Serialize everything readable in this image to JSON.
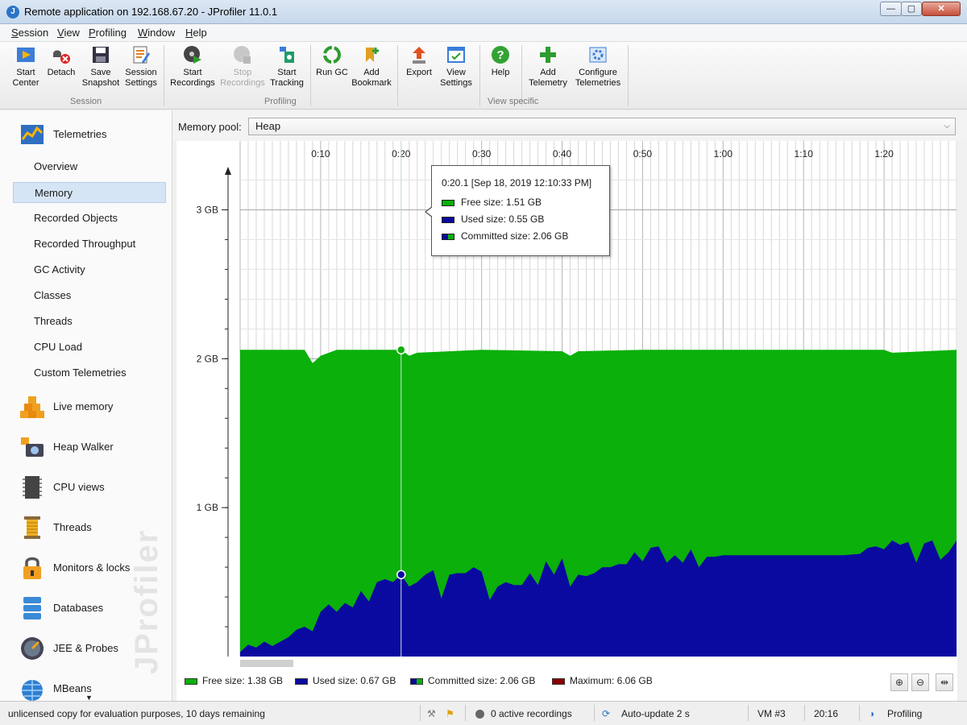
{
  "window": {
    "title": "Remote application on 192.168.67.20 - JProfiler 11.0.1",
    "min": "—",
    "max": "▢",
    "close": "✕"
  },
  "menu": [
    "Session",
    "View",
    "Profiling",
    "Window",
    "Help"
  ],
  "toolbar": {
    "buttons": [
      {
        "l1": "Start",
        "l2": "Center",
        "icon": "start-center-icon"
      },
      {
        "l1": "Detach",
        "l2": "",
        "icon": "detach-icon"
      },
      {
        "l1": "Save",
        "l2": "Snapshot",
        "icon": "save-icon"
      },
      {
        "l1": "Session",
        "l2": "Settings",
        "icon": "session-settings-icon"
      },
      {
        "l1": "Start",
        "l2": "Recordings",
        "icon": "start-recordings-icon"
      },
      {
        "l1": "Stop",
        "l2": "Recordings",
        "icon": "stop-recordings-icon"
      },
      {
        "l1": "Start",
        "l2": "Tracking",
        "icon": "start-tracking-icon"
      },
      {
        "l1": "Run GC",
        "l2": "",
        "icon": "run-gc-icon"
      },
      {
        "l1": "Add",
        "l2": "Bookmark",
        "icon": "add-bookmark-icon"
      },
      {
        "l1": "Export",
        "l2": "",
        "icon": "export-icon"
      },
      {
        "l1": "View",
        "l2": "Settings",
        "icon": "view-settings-icon"
      },
      {
        "l1": "Help",
        "l2": "",
        "icon": "help-icon"
      },
      {
        "l1": "Add",
        "l2": "Telemetry",
        "icon": "add-telemetry-icon"
      },
      {
        "l1": "Configure",
        "l2": "Telemetries",
        "icon": "configure-telemetries-icon"
      }
    ],
    "groups": [
      "Session",
      "Profiling",
      "View specific"
    ]
  },
  "sidebar": {
    "telemetries": "Telemetries",
    "items": [
      "Overview",
      "Memory",
      "Recorded Objects",
      "Recorded Throughput",
      "GC Activity",
      "Classes",
      "Threads",
      "CPU Load",
      "Custom Telemetries"
    ],
    "selected": "Memory",
    "sections": [
      "Live memory",
      "Heap Walker",
      "CPU views",
      "Threads",
      "Monitors & locks",
      "Databases",
      "JEE & Probes",
      "MBeans"
    ],
    "watermark": "JProfiler",
    "more": "▼"
  },
  "memory_pool": {
    "label": "Memory pool:",
    "value": "Heap",
    "chevron": "⌵"
  },
  "colors": {
    "free": "#0bb00b",
    "used": "#0a0aa0",
    "maximum": "#8b0000"
  },
  "chart_data": {
    "type": "area",
    "x_unit": "seconds",
    "x_ticks": [
      "0:10",
      "0:20",
      "0:30",
      "0:40",
      "0:50",
      "1:00",
      "1:10",
      "1:20"
    ],
    "x_tick_seconds": [
      10,
      20,
      30,
      40,
      50,
      60,
      70,
      80
    ],
    "x_range": [
      0,
      89
    ],
    "y_ticks": [
      "1 GB",
      "2 GB",
      "3 GB"
    ],
    "y_tick_values": [
      1,
      2,
      3
    ],
    "y_range": [
      0,
      3.3
    ],
    "y_unit": "GB",
    "series": [
      {
        "name": "Committed size",
        "x": [
          0,
          8,
          9,
          10,
          12,
          20,
          21,
          22,
          30,
          40,
          41,
          42,
          50,
          60,
          70,
          80,
          81,
          89
        ],
        "values": [
          2.06,
          2.06,
          1.97,
          2.02,
          2.06,
          2.06,
          2.02,
          2.04,
          2.06,
          2.05,
          2.02,
          2.05,
          2.06,
          2.06,
          2.06,
          2.06,
          2.04,
          2.06
        ]
      },
      {
        "name": "Used size",
        "x": [
          0,
          1,
          2,
          3,
          4,
          5,
          6,
          7,
          8,
          9,
          10,
          11,
          12,
          13,
          14,
          15,
          16,
          17,
          18,
          19,
          20,
          21,
          22,
          23,
          24,
          25,
          26,
          27,
          28,
          29,
          30,
          31,
          32,
          33,
          34,
          35,
          36,
          37,
          38,
          39,
          40,
          41,
          42,
          43,
          44,
          45,
          46,
          47,
          48,
          49,
          50,
          51,
          52,
          53,
          54,
          55,
          56,
          57,
          58,
          59,
          60,
          65,
          70,
          75,
          77,
          78,
          79,
          80,
          81,
          82,
          83,
          84,
          85,
          86,
          87,
          88,
          89
        ],
        "values": [
          0.03,
          0.08,
          0.06,
          0.1,
          0.07,
          0.1,
          0.13,
          0.18,
          0.2,
          0.17,
          0.3,
          0.35,
          0.3,
          0.36,
          0.33,
          0.44,
          0.37,
          0.5,
          0.52,
          0.5,
          0.55,
          0.47,
          0.5,
          0.55,
          0.58,
          0.39,
          0.55,
          0.56,
          0.56,
          0.6,
          0.57,
          0.38,
          0.47,
          0.5,
          0.48,
          0.48,
          0.56,
          0.48,
          0.64,
          0.55,
          0.66,
          0.47,
          0.55,
          0.54,
          0.56,
          0.6,
          0.6,
          0.62,
          0.62,
          0.7,
          0.64,
          0.73,
          0.74,
          0.63,
          0.68,
          0.63,
          0.72,
          0.6,
          0.67,
          0.67,
          0.68,
          0.68,
          0.68,
          0.68,
          0.69,
          0.73,
          0.74,
          0.72,
          0.78,
          0.75,
          0.77,
          0.63,
          0.76,
          0.78,
          0.65,
          0.7,
          0.78
        ]
      }
    ],
    "cursor_x": 20,
    "tooltip": {
      "time": "0:20.1 [Sep 18, 2019 12:10:33 PM]",
      "free": "Free size:  1.51 GB",
      "used": "Used size:  0.55 GB",
      "committed": "Committed size:  2.06 GB"
    },
    "legend": [
      "Free size: 1.38 GB",
      "Used size: 0.67 GB",
      "Committed size: 2.06 GB",
      "Maximum: 6.06 GB"
    ]
  },
  "zoom_buttons": [
    "zoom-in-icon",
    "zoom-out-icon",
    "fit-icon"
  ],
  "status": {
    "license": "unlicensed copy for evaluation purposes, 10 days remaining",
    "recordings": "0 active recordings",
    "autoupdate": "Auto-update 2 s",
    "vm": "VM #3",
    "time": "20:16",
    "mode": "Profiling"
  }
}
